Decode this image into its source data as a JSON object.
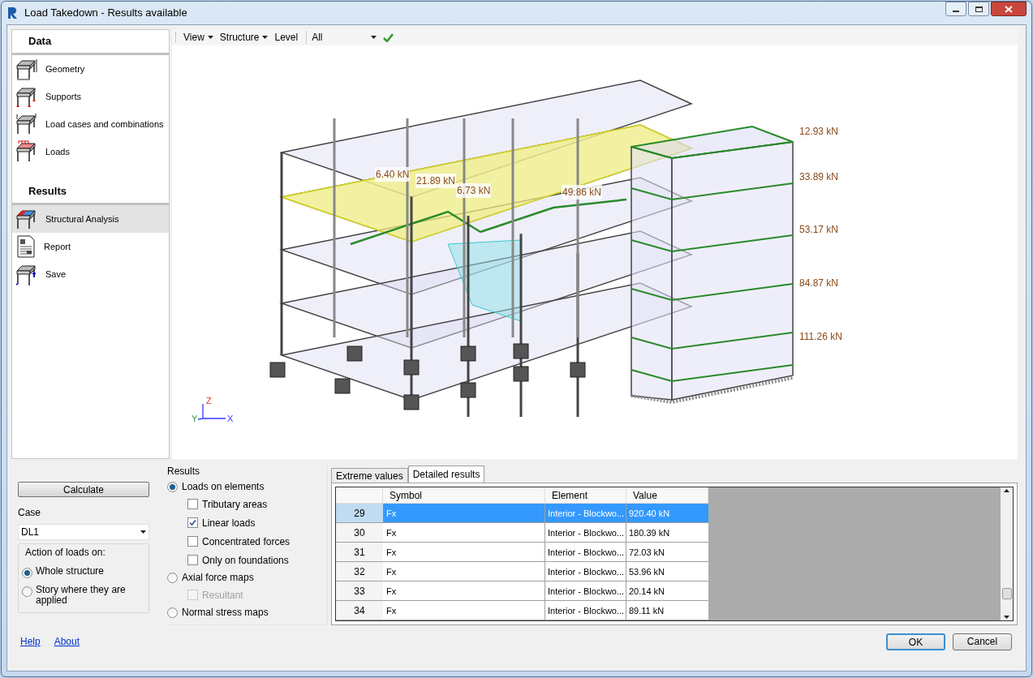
{
  "window": {
    "title": "Load Takedown - Results available"
  },
  "sidebar": {
    "sections": [
      {
        "title": "Data",
        "items": [
          {
            "label": "Geometry",
            "selected": false
          },
          {
            "label": "Supports",
            "selected": false
          },
          {
            "label": "Load cases and combinations",
            "selected": false
          },
          {
            "label": "Loads",
            "selected": false
          }
        ]
      },
      {
        "title": "Results",
        "items": [
          {
            "label": "Structural Analysis",
            "selected": true
          },
          {
            "label": "Report",
            "selected": false
          },
          {
            "label": "Save",
            "selected": false
          }
        ]
      }
    ]
  },
  "toolbar": {
    "menus": [
      "View",
      "Structure",
      "Level"
    ],
    "level_value": "All"
  },
  "view": {
    "labels": [
      {
        "text": "12.93 kN"
      },
      {
        "text": "33.89 kN"
      },
      {
        "text": "53.17 kN"
      },
      {
        "text": "84.87 kN"
      },
      {
        "text": "111.26 kN"
      },
      {
        "text": "6.40 kN"
      },
      {
        "text": "21.89 kN"
      },
      {
        "text": "6.73 kN"
      },
      {
        "text": "49.86 kN"
      }
    ],
    "axes": [
      "Z",
      "Y",
      "X"
    ]
  },
  "controls": {
    "calculate": "Calculate",
    "case": {
      "label": "Case",
      "value": "DL1"
    },
    "action": {
      "title": "Action of loads on:",
      "options": [
        {
          "label": "Whole structure",
          "selected": true
        },
        {
          "label": "Story where they are applied",
          "selected": false
        }
      ]
    }
  },
  "results": {
    "title": "Results",
    "options": [
      {
        "label": "Loads on elements",
        "selected": true,
        "children": [
          {
            "label": "Tributary areas",
            "checked": false,
            "disabled": false
          },
          {
            "label": "Linear loads",
            "checked": true,
            "disabled": false
          },
          {
            "label": "Concentrated forces",
            "checked": false,
            "disabled": false
          },
          {
            "label": "Only on foundations",
            "checked": false,
            "disabled": false
          }
        ]
      },
      {
        "label": "Axial force maps",
        "selected": false,
        "children": [
          {
            "label": "Resultant",
            "checked": false,
            "disabled": true
          }
        ]
      },
      {
        "label": "Normal stress maps",
        "selected": false
      }
    ]
  },
  "tabs": [
    {
      "label": "Extreme values",
      "selected": false
    },
    {
      "label": "Detailed results",
      "selected": true
    }
  ],
  "table": {
    "columns": [
      "Symbol",
      "Element",
      "Value"
    ],
    "rows": [
      {
        "index": "29",
        "symbol": "Fx",
        "element": "Interior - Blockwo...",
        "value": "920.40 kN",
        "selected": true
      },
      {
        "index": "30",
        "symbol": "Fx",
        "element": "Interior - Blockwo...",
        "value": "180.39 kN",
        "selected": false
      },
      {
        "index": "31",
        "symbol": "Fx",
        "element": "Interior - Blockwo...",
        "value": "72.03 kN",
        "selected": false
      },
      {
        "index": "32",
        "symbol": "Fx",
        "element": "Interior - Blockwo...",
        "value": "53.96 kN",
        "selected": false
      },
      {
        "index": "33",
        "symbol": "Fx",
        "element": "Interior - Blockwo...",
        "value": "20.14 kN",
        "selected": false
      },
      {
        "index": "34",
        "symbol": "Fx",
        "element": "Interior - Blockwo...",
        "value": "89.11 kN",
        "selected": false
      }
    ]
  },
  "footer": {
    "links": [
      "Help",
      "About"
    ],
    "buttons": [
      {
        "label": "OK",
        "default": true
      },
      {
        "label": "Cancel",
        "default": false
      }
    ]
  }
}
